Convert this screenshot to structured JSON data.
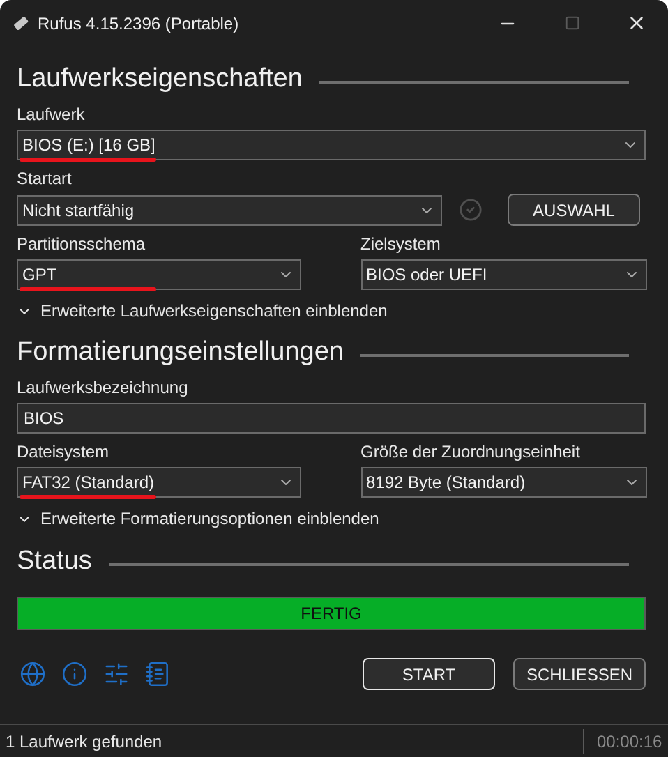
{
  "window": {
    "title": "Rufus 4.15.2396 (Portable)"
  },
  "drive_properties": {
    "heading": "Laufwerkseigenschaften",
    "device": {
      "label": "Laufwerk",
      "value": "BIOS (E:) [16 GB]",
      "underlined": true
    },
    "boot_selection": {
      "label": "Startart",
      "value": "Nicht startfähig",
      "button": "AUSWAHL"
    },
    "partition_scheme": {
      "label": "Partitionsschema",
      "value": "GPT",
      "underlined": true
    },
    "target_system": {
      "label": "Zielsystem",
      "value": "BIOS oder UEFI",
      "underlined": false
    },
    "advanced": {
      "label": "Erweiterte Laufwerkseigenschaften einblenden",
      "expanded": false
    }
  },
  "format_options": {
    "heading": "Formatierungseinstellungen",
    "volume_label": {
      "label": "Laufwerksbezeichnung",
      "value": "BIOS"
    },
    "file_system": {
      "label": "Dateisystem",
      "value": "FAT32 (Standard)",
      "underlined": true
    },
    "cluster_size": {
      "label": "Größe der Zuordnungseinheit",
      "value": "8192 Byte (Standard)",
      "underlined": false
    },
    "advanced": {
      "label": "Erweiterte Formatierungsoptionen einblenden",
      "expanded": false
    }
  },
  "status": {
    "heading": "Status",
    "progress": {
      "label": "FERTIG",
      "level": 1
    }
  },
  "buttons": [
    {
      "label": "START",
      "focused": true
    },
    {
      "label": "SCHLIESSEN",
      "focused": false
    }
  ],
  "status_bar": {
    "message": "1 Laufwerk gefunden",
    "time": "00:00:16"
  }
}
